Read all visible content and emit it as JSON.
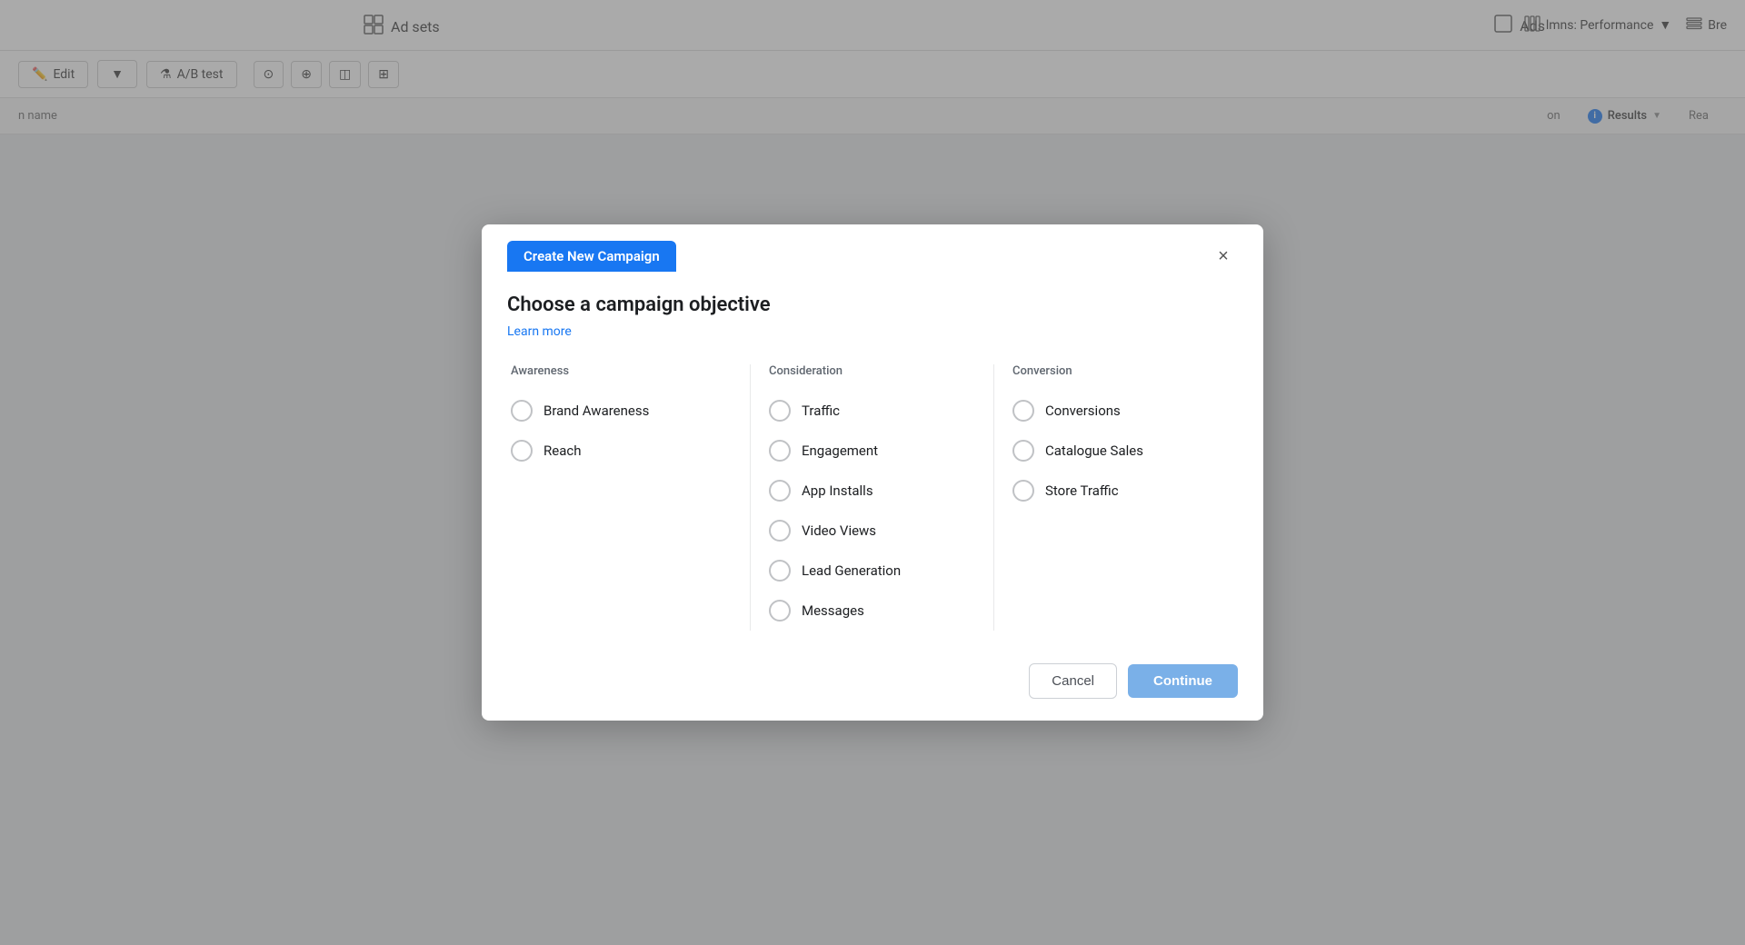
{
  "background": {
    "top_tabs": [
      {
        "id": "ad-sets",
        "label": "Ad sets",
        "icon": "grid-icon"
      },
      {
        "id": "ads",
        "label": "Ads",
        "icon": "square-icon"
      }
    ],
    "toolbar": {
      "edit_label": "Edit",
      "ab_test_label": "A/B test"
    },
    "table_header": {
      "campaign_name_label": "n name",
      "on_label": "on",
      "results_label": "Results",
      "reach_label": "Rea",
      "columns_label": "lmns: Performance",
      "breakdowns_label": "Bre"
    }
  },
  "modal": {
    "title": "Create New Campaign",
    "close_label": "×",
    "headline": "Choose a campaign objective",
    "learn_more_label": "Learn more",
    "columns": [
      {
        "id": "awareness",
        "label": "Awareness",
        "options": [
          {
            "id": "brand-awareness",
            "label": "Brand Awareness",
            "selected": false
          },
          {
            "id": "reach",
            "label": "Reach",
            "selected": false
          }
        ]
      },
      {
        "id": "consideration",
        "label": "Consideration",
        "options": [
          {
            "id": "traffic",
            "label": "Traffic",
            "selected": false
          },
          {
            "id": "engagement",
            "label": "Engagement",
            "selected": false
          },
          {
            "id": "app-installs",
            "label": "App Installs",
            "selected": false
          },
          {
            "id": "video-views",
            "label": "Video Views",
            "selected": false
          },
          {
            "id": "lead-generation",
            "label": "Lead Generation",
            "selected": false
          },
          {
            "id": "messages",
            "label": "Messages",
            "selected": false
          }
        ]
      },
      {
        "id": "conversion",
        "label": "Conversion",
        "options": [
          {
            "id": "conversions",
            "label": "Conversions",
            "selected": false
          },
          {
            "id": "catalogue-sales",
            "label": "Catalogue Sales",
            "selected": false
          },
          {
            "id": "store-traffic",
            "label": "Store Traffic",
            "selected": false
          }
        ]
      }
    ],
    "footer": {
      "cancel_label": "Cancel",
      "continue_label": "Continue"
    }
  }
}
